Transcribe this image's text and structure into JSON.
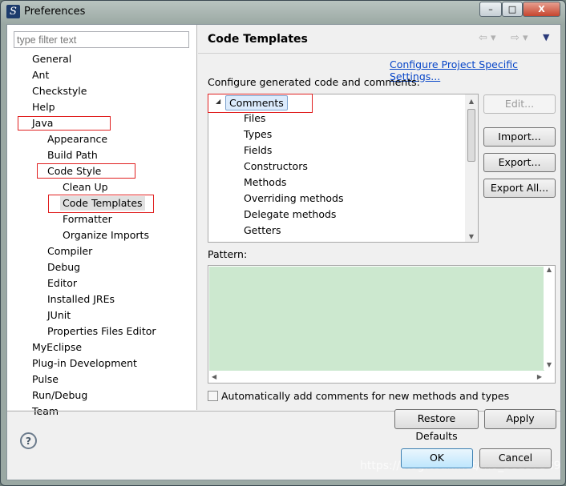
{
  "window": {
    "title": "Preferences",
    "controls": {
      "minimize": "–",
      "maximize": "□",
      "close": "X"
    }
  },
  "filter": {
    "placeholder": "type filter text"
  },
  "tree": [
    {
      "label": "General",
      "level": 0
    },
    {
      "label": "Ant",
      "level": 0
    },
    {
      "label": "Checkstyle",
      "level": 0
    },
    {
      "label": "Help",
      "level": 0
    },
    {
      "label": "Java",
      "level": 0
    },
    {
      "label": "Appearance",
      "level": 1
    },
    {
      "label": "Build Path",
      "level": 1
    },
    {
      "label": "Code Style",
      "level": 1
    },
    {
      "label": "Clean Up",
      "level": 2
    },
    {
      "label": "Code Templates",
      "level": 2,
      "selected": true
    },
    {
      "label": "Formatter",
      "level": 2
    },
    {
      "label": "Organize Imports",
      "level": 2
    },
    {
      "label": "Compiler",
      "level": 1
    },
    {
      "label": "Debug",
      "level": 1
    },
    {
      "label": "Editor",
      "level": 1
    },
    {
      "label": "Installed JREs",
      "level": 1
    },
    {
      "label": "JUnit",
      "level": 1
    },
    {
      "label": "Properties Files Editor",
      "level": 1
    },
    {
      "label": "MyEclipse",
      "level": 0
    },
    {
      "label": "Plug-in Development",
      "level": 0
    },
    {
      "label": "Pulse",
      "level": 0
    },
    {
      "label": "Run/Debug",
      "level": 0
    },
    {
      "label": "Team",
      "level": 0
    }
  ],
  "page": {
    "title": "Code Templates",
    "project_link": "Configure Project Specific Settings...",
    "configure_label": "Configure generated code and comments:",
    "templates": {
      "group": "Comments",
      "items": [
        "Files",
        "Types",
        "Fields",
        "Constructors",
        "Methods",
        "Overriding methods",
        "Delegate methods",
        "Getters"
      ]
    },
    "buttons": {
      "edit": "Edit...",
      "import": "Import...",
      "export": "Export...",
      "export_all": "Export All..."
    },
    "pattern_label": "Pattern:",
    "auto_comments": {
      "label": "Automatically add comments for new methods and types",
      "checked": false
    },
    "restore": "Restore Defaults",
    "apply": "Apply"
  },
  "footer": {
    "help": "?",
    "ok": "OK",
    "cancel": "Cancel",
    "watermark": "https://blog.csdn.net/m0_38137589"
  },
  "colors": {
    "pattern_bg": "#cce8cf",
    "link": "#0645c8",
    "highlight": "#e02020"
  }
}
